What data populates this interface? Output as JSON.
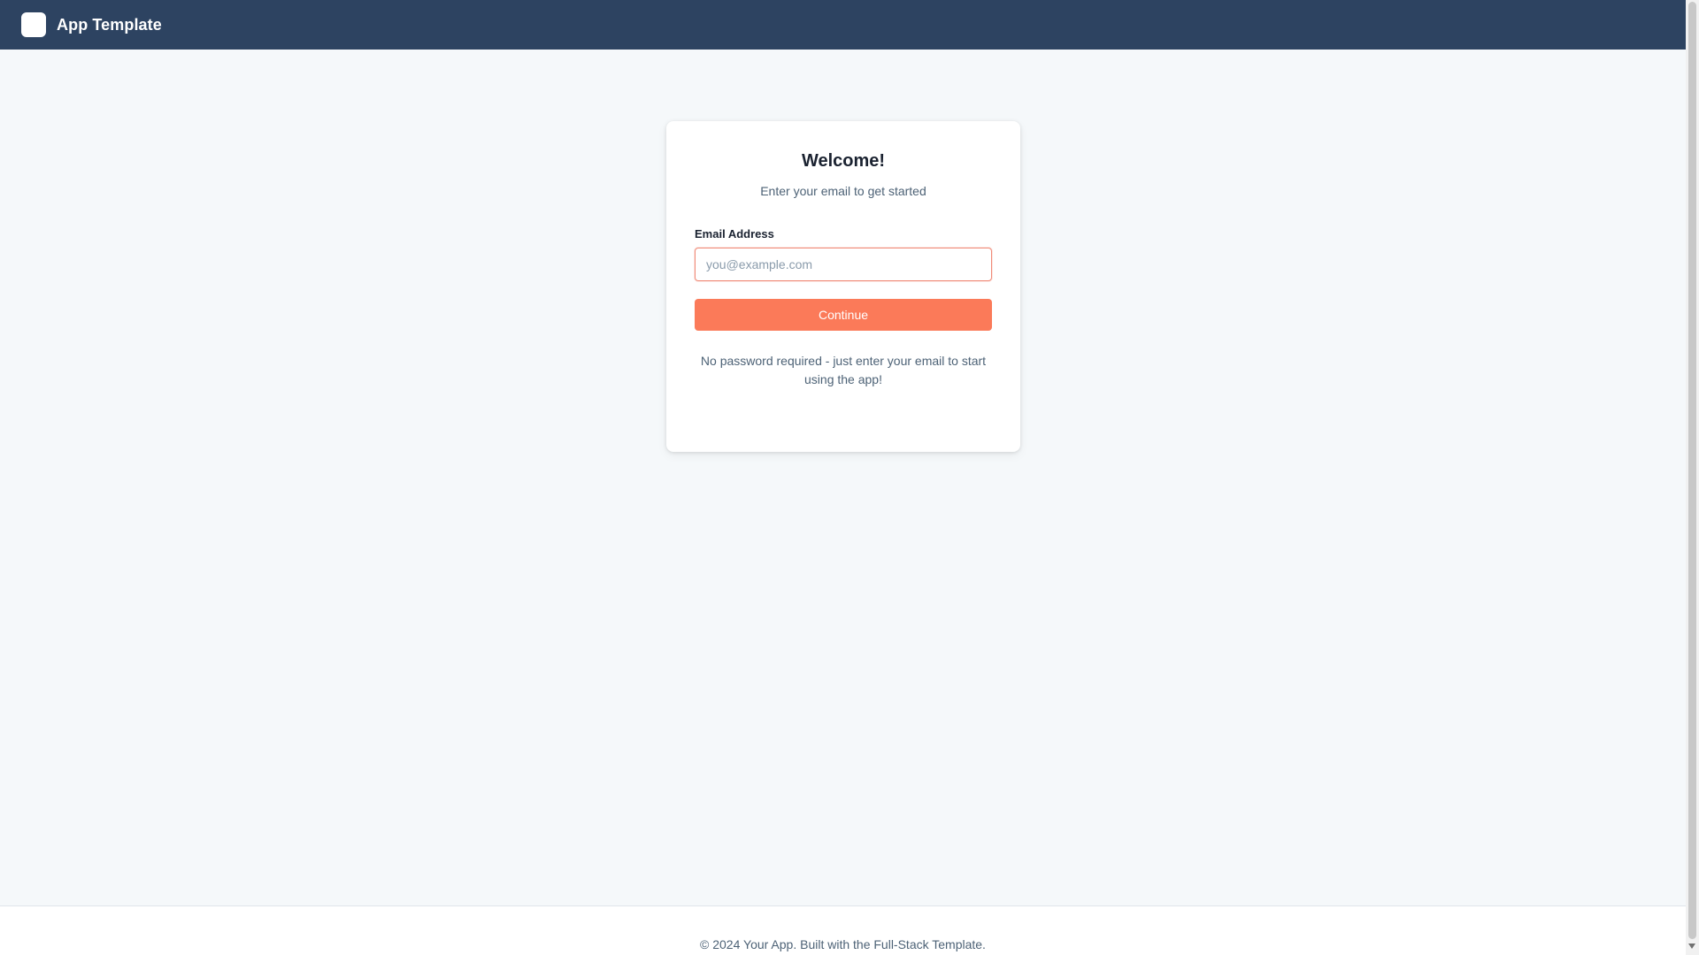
{
  "header": {
    "app_title": "App Template",
    "logo_icon": "app-logo-icon",
    "background_color": "#2d4361"
  },
  "login": {
    "title": "Welcome!",
    "subtitle": "Enter your email to get started",
    "email_label": "Email Address",
    "email_value": "",
    "email_placeholder": "you@example.com",
    "continue_label": "Continue",
    "help_text": "No password required - just enter your email to start using the app!",
    "accent_color": "#fb7a59"
  },
  "footer": {
    "text": "© 2024 Your App. Built with the Full-Stack Template."
  }
}
